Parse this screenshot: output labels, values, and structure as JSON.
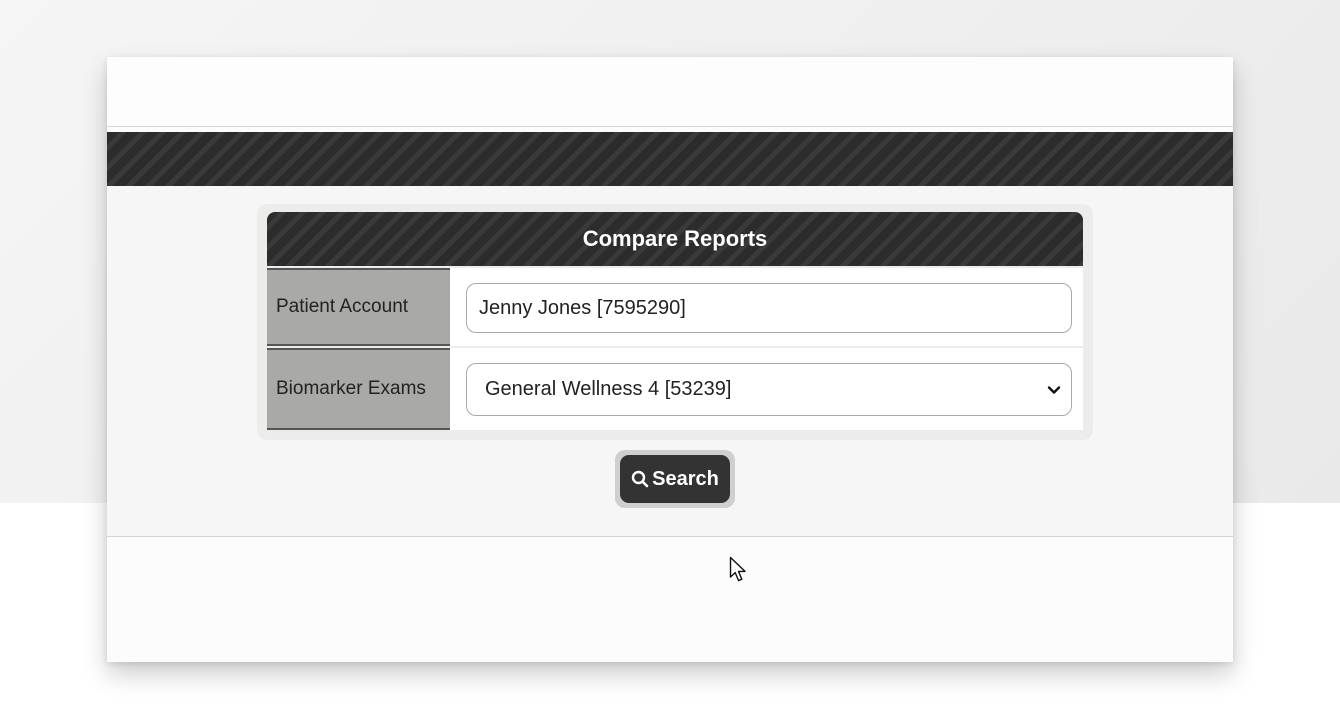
{
  "panel": {
    "title": "Compare Reports"
  },
  "form": {
    "patient_account": {
      "label": "Patient Account",
      "value": "Jenny Jones [7595290]"
    },
    "biomarker_exams": {
      "label": "Biomarker Exams",
      "selected": "General Wellness 4 [53239]"
    }
  },
  "actions": {
    "search_label": "Search",
    "search_icon": "search-icon"
  },
  "colors": {
    "header_dark": "#2f2f2f",
    "label_bg": "#a9a9a7",
    "button_bg": "#333333"
  }
}
